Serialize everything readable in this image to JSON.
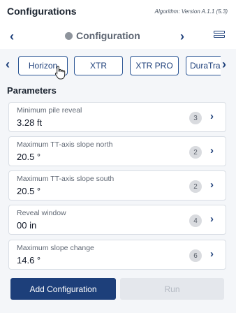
{
  "header": {
    "title": "Configurations",
    "version": "Algorithm: Version A.1.1 (5.3)"
  },
  "config_nav": {
    "prev_icon": "‹",
    "next_icon": "›",
    "title": "Configuration",
    "status_color": "#8e949c",
    "list_icon": "list-icon"
  },
  "tabs": {
    "left_arrow": "‹",
    "right_arrow": "›",
    "items": [
      {
        "label": "Horizon"
      },
      {
        "label": "XTR"
      },
      {
        "label": "XTR PRO"
      },
      {
        "label": "DuraTra"
      }
    ]
  },
  "parameters": {
    "heading": "Parameters",
    "items": [
      {
        "label": "Minimum pile reveal",
        "value": "3.28 ft",
        "badge": "3"
      },
      {
        "label": "Maximum TT-axis slope north",
        "value": "20.5 °",
        "badge": "2"
      },
      {
        "label": "Maximum TT-axis slope south",
        "value": "20.5 °",
        "badge": "2"
      },
      {
        "label": "Reveal window",
        "value": "00 in",
        "badge": "4"
      },
      {
        "label": "Maximum slope change",
        "value": "14.6 °",
        "badge": "6"
      }
    ],
    "chevron": "›"
  },
  "actions": {
    "add_label": "Add Configuration",
    "run_label": "Run"
  },
  "colors": {
    "accent": "#1d3f7a",
    "disabled": "#e4e7ec"
  }
}
